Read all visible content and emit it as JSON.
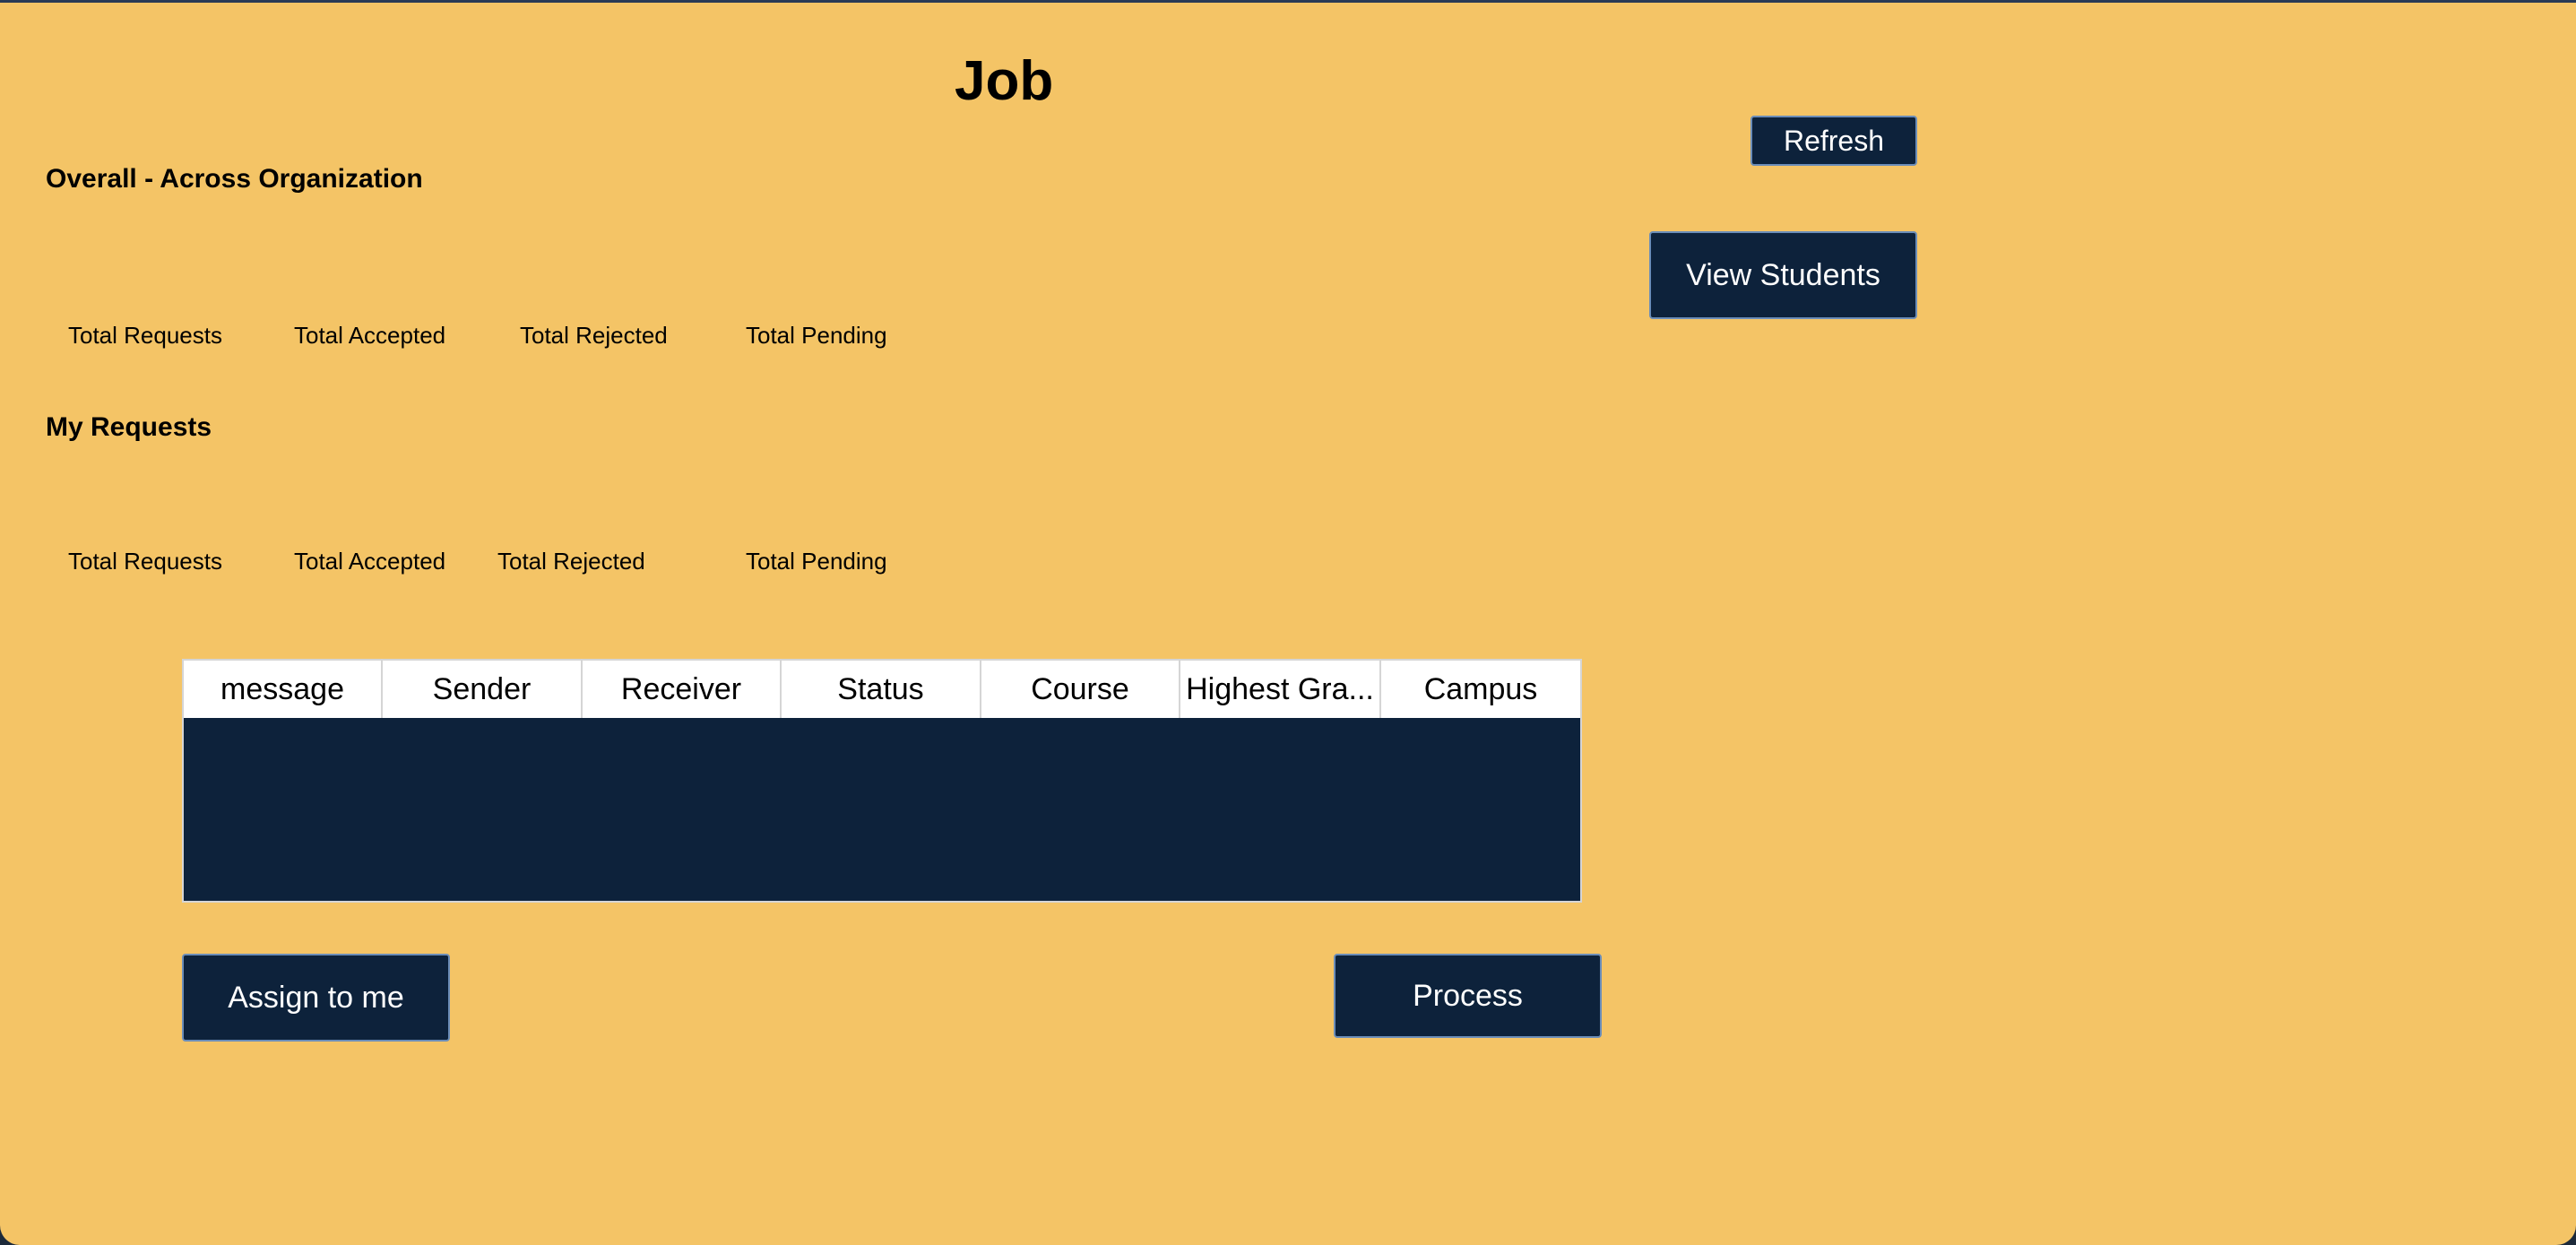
{
  "window": {
    "title": "Job"
  },
  "overall": {
    "heading": "Overall - Across Organization",
    "stats": [
      "Total Requests",
      "Total Accepted",
      "Total Rejected",
      "Total Pending"
    ]
  },
  "mine": {
    "heading": "My Requests",
    "stats": [
      "Total Requests",
      "Total Accepted",
      "Total Rejected",
      "Total Pending"
    ]
  },
  "buttons": {
    "refresh": "Refresh",
    "view_students": "View Students",
    "assign": "Assign to me",
    "process": "Process"
  },
  "table": {
    "columns": [
      "message",
      "Sender",
      "Receiver",
      "Status",
      "Course",
      "Highest Gra...",
      "Campus"
    ],
    "rows": []
  },
  "colors": {
    "background": "#f4c466",
    "button": "#0d223b",
    "table_body": "#0d223b",
    "header_bg": "#ffffff"
  }
}
